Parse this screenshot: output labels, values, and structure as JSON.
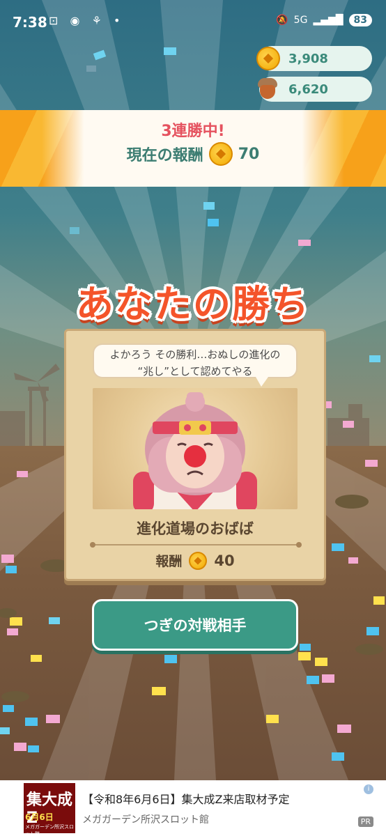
{
  "status_bar": {
    "time": "7:38",
    "network": "5G",
    "battery": "83"
  },
  "currency": {
    "coins": "3,908",
    "acorns": "6,620"
  },
  "banner": {
    "streak_text": "3連勝中!",
    "current_reward_label": "現在の報酬",
    "current_reward_value": "70"
  },
  "result": {
    "title": "あなたの勝ち"
  },
  "opponent": {
    "speech_line1": "よかろう その勝利…おぬしの進化の",
    "speech_line2": "“兆し”として認めてやる",
    "name": "進化道場のおばば",
    "reward_label": "報酬",
    "reward_value": "40"
  },
  "buttons": {
    "next_opponent": "つぎの対戦相手"
  },
  "ad": {
    "title": "【令和8年6月6日】集大成Z来店取材予定",
    "subtitle": "メガガーデン所沢スロット館",
    "badge": "PR",
    "image_big": "集大成Z",
    "image_date": "6月6日",
    "image_store": "メガガーデン所沢スロット館"
  },
  "colors": {
    "accent_green": "#3b9a86",
    "victory_orange": "#f4542a",
    "banner_orange": "#f7a11a"
  },
  "icons": [
    "coin-icon",
    "acorn-icon",
    "signal-icon",
    "battery-icon",
    "info-icon"
  ]
}
